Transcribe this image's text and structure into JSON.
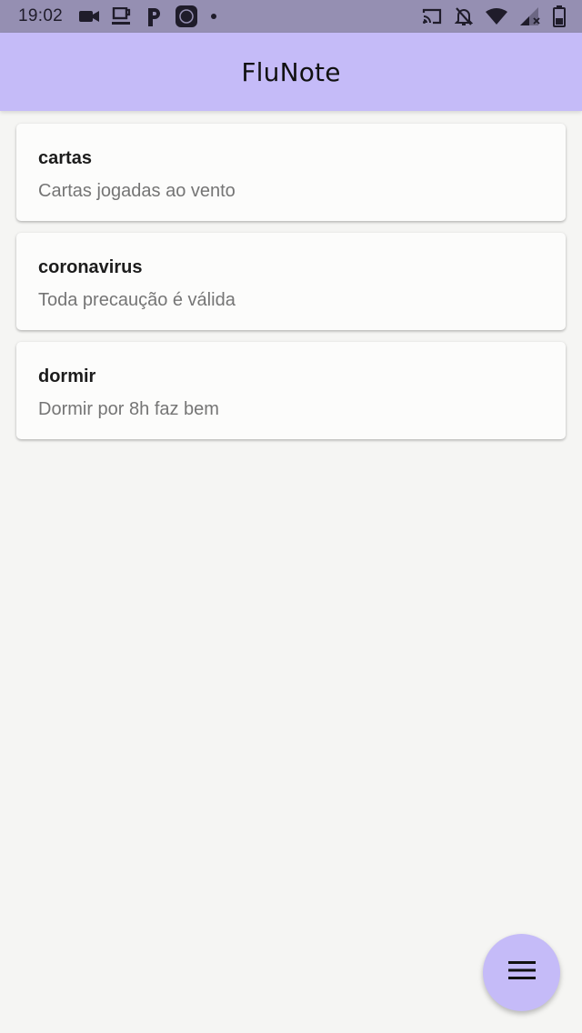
{
  "status_bar": {
    "time": "19:02",
    "left_icons": [
      "video-icon",
      "cup-icon",
      "p-app-icon",
      "circle-app-icon",
      "dot-icon"
    ],
    "right_icons": [
      "cast-icon",
      "mute-icon",
      "wifi-icon",
      "signal-icon",
      "battery-icon"
    ]
  },
  "app_bar": {
    "title": "FluNote"
  },
  "notes": [
    {
      "title": "cartas",
      "description": "Cartas jogadas ao vento"
    },
    {
      "title": "coronavirus",
      "description": "Toda precaução é válida"
    },
    {
      "title": "dormir",
      "description": "Dormir por 8h faz bem"
    }
  ],
  "fab": {
    "icon": "menu-icon"
  },
  "colors": {
    "status_bar": "#958fb2",
    "app_bar": "#c5bbf8",
    "background": "#f5f5f3",
    "card": "#fcfcfb",
    "description_text": "#757575"
  }
}
